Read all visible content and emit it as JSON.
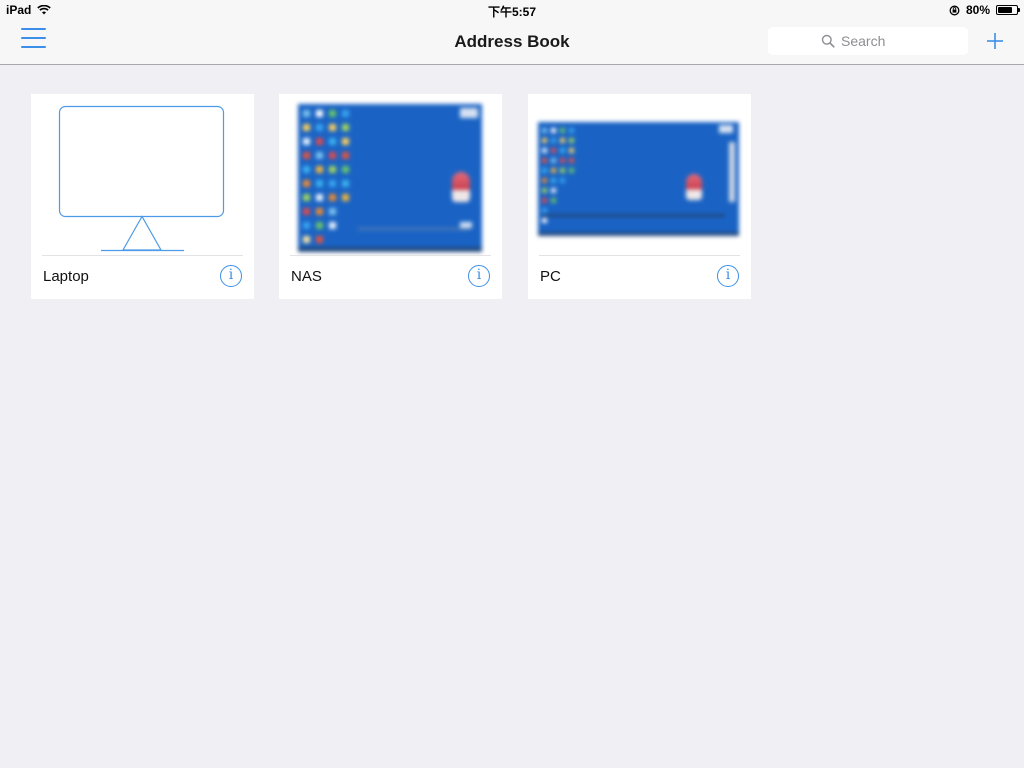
{
  "status_bar": {
    "device": "iPad",
    "time": "下午5:57",
    "battery_percent": "80%",
    "battery_level": 0.8
  },
  "nav": {
    "title": "Address Book",
    "search_placeholder": "Search"
  },
  "devices": [
    {
      "name": "Laptop",
      "thumbnail": "monitor-outline-icon"
    },
    {
      "name": "NAS",
      "thumbnail": "desktop-screenshot"
    },
    {
      "name": "PC",
      "thumbnail": "desktop-screenshot"
    }
  ],
  "colors": {
    "accent": "#3d8ee8",
    "background": "#efeff4",
    "desktop_blue": "#1a63c4"
  }
}
